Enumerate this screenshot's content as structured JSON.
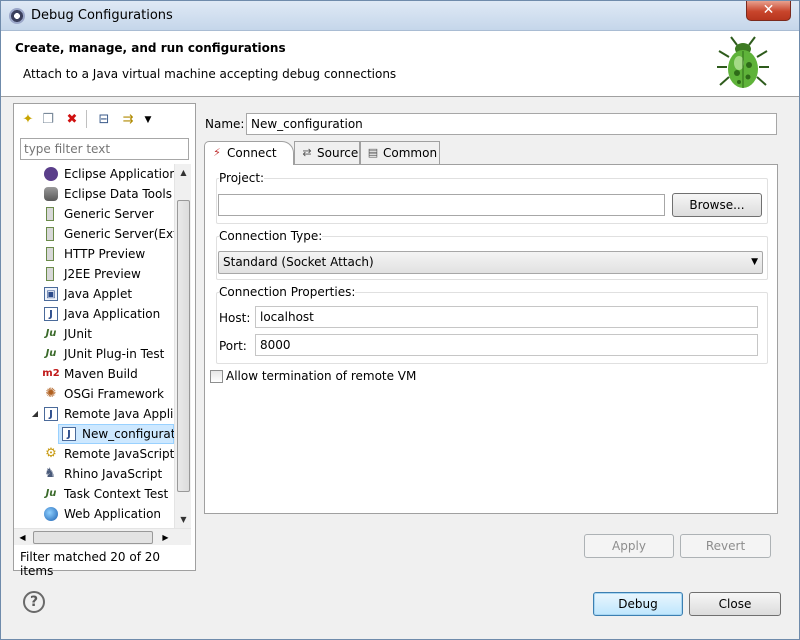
{
  "window": {
    "title": "Debug Configurations",
    "close_glyph": "✕"
  },
  "banner": {
    "heading": "Create, manage, and run configurations",
    "subtitle": "Attach to a Java virtual machine accepting debug connections"
  },
  "left": {
    "toolbar_icons": [
      "new-launch-config-icon",
      "duplicate-icon",
      "delete-icon",
      "collapse-all-icon",
      "filter-icon",
      "view-menu-icon"
    ],
    "filter_placeholder": "type filter text",
    "items": [
      {
        "label": "Eclipse Application",
        "icon": "eclipse-icon"
      },
      {
        "label": "Eclipse Data Tools",
        "icon": "database-icon"
      },
      {
        "label": "Generic Server",
        "icon": "server-icon"
      },
      {
        "label": "Generic Server(Exte",
        "icon": "server-icon"
      },
      {
        "label": "HTTP Preview",
        "icon": "server-icon"
      },
      {
        "label": "J2EE Preview",
        "icon": "server-icon"
      },
      {
        "label": "Java Applet",
        "icon": "applet-icon"
      },
      {
        "label": "Java Application",
        "icon": "java-app-icon"
      },
      {
        "label": "JUnit",
        "icon": "junit-icon"
      },
      {
        "label": "JUnit Plug-in Test",
        "icon": "junit-plugin-icon"
      },
      {
        "label": "Maven Build",
        "icon": "maven-icon"
      },
      {
        "label": "OSGi Framework",
        "icon": "osgi-icon"
      },
      {
        "label": "Remote Java Appli",
        "icon": "remote-java-icon"
      },
      {
        "label": "New_configurati",
        "icon": "remote-java-icon"
      },
      {
        "label": "Remote JavaScript",
        "icon": "remote-js-icon"
      },
      {
        "label": "Rhino JavaScript",
        "icon": "rhino-icon"
      },
      {
        "label": "Task Context Test",
        "icon": "task-context-icon"
      },
      {
        "label": "Web Application",
        "icon": "web-app-icon"
      }
    ],
    "filter_status": "Filter matched 20 of 20 items"
  },
  "right": {
    "name_label": "Name:",
    "name_value": "New_configuration",
    "tabs": [
      {
        "label": "Connect",
        "icon": "connect-icon"
      },
      {
        "label": "Source",
        "icon": "source-icon"
      },
      {
        "label": "Common",
        "icon": "common-icon"
      }
    ],
    "project_label": "Project:",
    "project_value": "",
    "browse_label": "Browse...",
    "connection_type_label": "Connection Type:",
    "connection_type_value": "Standard (Socket Attach)",
    "connection_props_label": "Connection Properties:",
    "host_label": "Host:",
    "host_value": "localhost",
    "port_label": "Port:",
    "port_value": "8000",
    "allow_termination_label": "Allow termination of remote VM",
    "allow_termination_checked": false,
    "apply_label": "Apply",
    "revert_label": "Revert"
  },
  "footer": {
    "help_glyph": "?",
    "debug_label": "Debug",
    "close_label": "Close"
  }
}
